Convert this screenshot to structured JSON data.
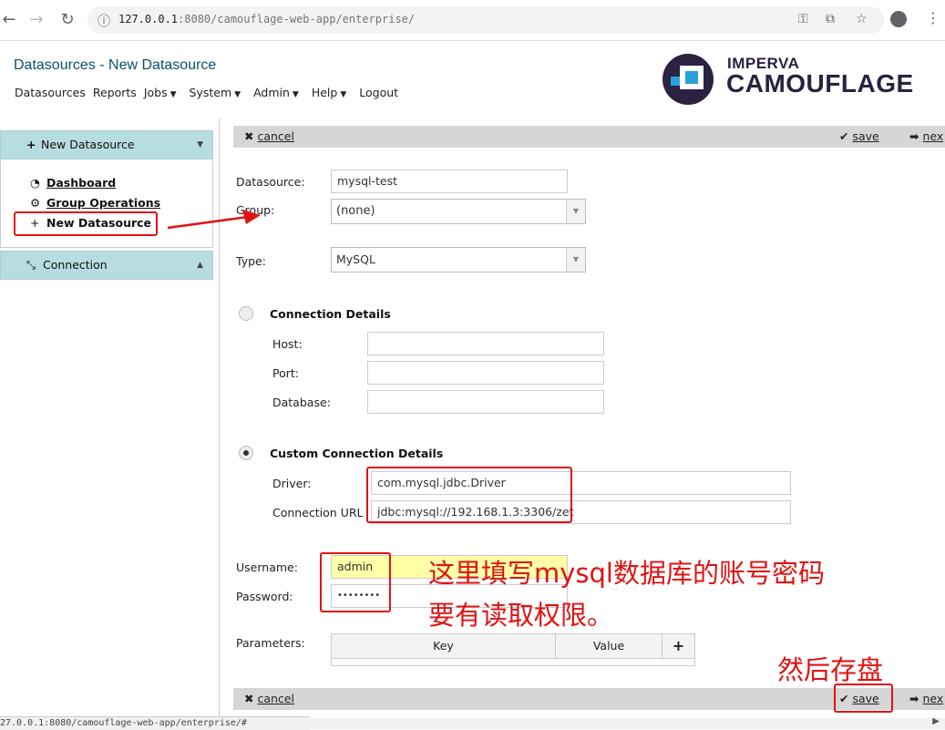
{
  "browser": {
    "back_icon": "←",
    "forward_icon": "→",
    "reload_icon": "↻",
    "url_host": "127.0.0.1",
    "url_rest": ":8080/camouflage-web-app/enterprise/",
    "status_url": "27.0.0.1:8080/camouflage-web-app/enterprise/#"
  },
  "header": {
    "title": "Datasources - New Datasource",
    "nav": [
      "Datasources",
      "Reports",
      "Jobs",
      "System",
      "Admin",
      "Help",
      "Logout"
    ],
    "logo_line1": "IMPERVA",
    "logo_line2": "CAMOUFLAGE"
  },
  "sidebar": {
    "new_datasource_header": "New Datasource",
    "links": [
      {
        "icon": "dashboard-icon",
        "glyph": "◔",
        "label": "Dashboard"
      },
      {
        "icon": "group-operations-icon",
        "glyph": "⚙",
        "label": "Group Operations"
      },
      {
        "icon": "plus-icon",
        "glyph": "+",
        "label": "New Datasource"
      }
    ],
    "connection_header": "Connection"
  },
  "toolbar": {
    "cancel": "cancel",
    "save": "save",
    "next": "nex"
  },
  "form": {
    "datasource_label": "Datasource:",
    "datasource_value": "mysql-test",
    "group_label": "Group:",
    "group_value": "(none)",
    "type_label": "Type:",
    "type_value": "MySQL",
    "connection_details": "Connection Details",
    "host_label": "Host:",
    "port_label": "Port:",
    "database_label": "Database:",
    "custom_connection_details": "Custom Connection Details",
    "driver_label": "Driver:",
    "driver_value": "com.mysql.jdbc.Driver",
    "url_label": "Connection URL",
    "url_value": "jdbc:mysql://192.168.1.3:3306/zet",
    "username_label": "Username:",
    "username_value": "admin",
    "password_label": "Password:",
    "password_value": "••••••••",
    "parameters_label": "Parameters:",
    "param_key": "Key",
    "param_value": "Value",
    "param_add": "+"
  },
  "annotations": {
    "note_line1": "这里填写mysql数据库的账号密码",
    "note_line2": "要有读取权限。",
    "save_note": "然后存盘",
    "color": "#e01212"
  }
}
